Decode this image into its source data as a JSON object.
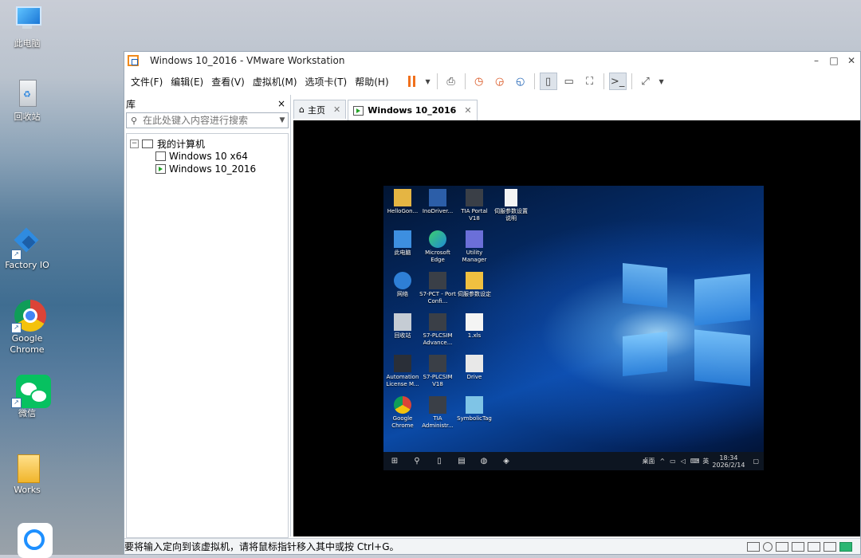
{
  "desktop": {
    "icons": [
      {
        "label": "此电脑",
        "icon": "computer-icon"
      },
      {
        "label": "回收站",
        "icon": "recycle-bin-icon"
      },
      {
        "label": "Factory IO",
        "icon": "factory-io-icon"
      },
      {
        "label": "Google Chrome",
        "icon": "chrome-icon"
      },
      {
        "label": "微信",
        "icon": "wechat-icon"
      },
      {
        "label": "Works",
        "icon": "folder-icon"
      }
    ]
  },
  "window": {
    "title": "Windows 10_2016 - VMware Workstation",
    "menu": [
      "文件(F)",
      "编辑(E)",
      "查看(V)",
      "虚拟机(M)",
      "选项卡(T)",
      "帮助(H)"
    ],
    "library": {
      "title": "库",
      "close": "×",
      "search_placeholder": "在此处键入内容进行搜索",
      "tree": {
        "root": "我的计算机",
        "items": [
          "Windows 10 x64",
          "Windows 10_2016"
        ]
      }
    },
    "tabs": [
      {
        "label": "主页"
      },
      {
        "label": "Windows 10_2016"
      }
    ],
    "status_message": "要将输入定向到该虚拟机，请将鼠标指针移入其中或按 Ctrl+G。"
  },
  "guest": {
    "icons": [
      {
        "label": "HelloGon..."
      },
      {
        "label": "InoDriver..."
      },
      {
        "label": "TIA Portal V18"
      },
      {
        "label": "伺服参数设置说明"
      },
      {
        "label": "此电脑"
      },
      {
        "label": "Microsoft Edge"
      },
      {
        "label": "Utility Manager"
      },
      {
        "label": "网络"
      },
      {
        "label": "S7-PCT - Port Confi..."
      },
      {
        "label": "伺服参数设定"
      },
      {
        "label": "回收站"
      },
      {
        "label": "S7-PLCSIM Advance..."
      },
      {
        "label": "1.xls"
      },
      {
        "label": "Automation License M..."
      },
      {
        "label": "S7-PLCSIM V18"
      },
      {
        "label": "Drive"
      },
      {
        "label": "Google Chrome"
      },
      {
        "label": "TIA Administr..."
      },
      {
        "label": "SymbolicTag"
      }
    ],
    "taskbar": {
      "desktop_label": "桌面",
      "lang": "英",
      "time": "18:34",
      "date": "2026/2/14"
    }
  },
  "colors": {
    "accent_orange": "#f0701c",
    "run_green": "#22a325"
  }
}
